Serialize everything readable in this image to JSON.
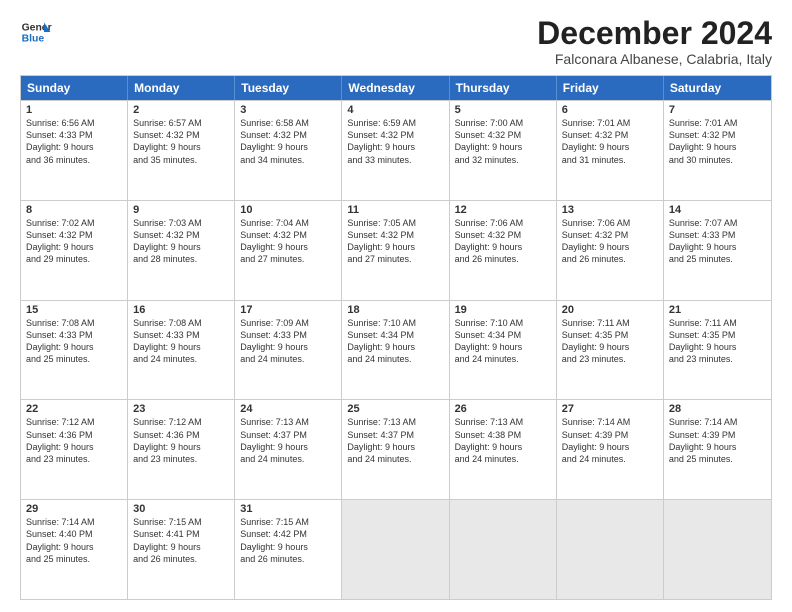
{
  "logo": {
    "line1": "General",
    "line2": "Blue"
  },
  "title": "December 2024",
  "location": "Falconara Albanese, Calabria, Italy",
  "headers": [
    "Sunday",
    "Monday",
    "Tuesday",
    "Wednesday",
    "Thursday",
    "Friday",
    "Saturday"
  ],
  "rows": [
    [
      {
        "day": "1",
        "lines": [
          "Sunrise: 6:56 AM",
          "Sunset: 4:33 PM",
          "Daylight: 9 hours",
          "and 36 minutes."
        ]
      },
      {
        "day": "2",
        "lines": [
          "Sunrise: 6:57 AM",
          "Sunset: 4:32 PM",
          "Daylight: 9 hours",
          "and 35 minutes."
        ]
      },
      {
        "day": "3",
        "lines": [
          "Sunrise: 6:58 AM",
          "Sunset: 4:32 PM",
          "Daylight: 9 hours",
          "and 34 minutes."
        ]
      },
      {
        "day": "4",
        "lines": [
          "Sunrise: 6:59 AM",
          "Sunset: 4:32 PM",
          "Daylight: 9 hours",
          "and 33 minutes."
        ]
      },
      {
        "day": "5",
        "lines": [
          "Sunrise: 7:00 AM",
          "Sunset: 4:32 PM",
          "Daylight: 9 hours",
          "and 32 minutes."
        ]
      },
      {
        "day": "6",
        "lines": [
          "Sunrise: 7:01 AM",
          "Sunset: 4:32 PM",
          "Daylight: 9 hours",
          "and 31 minutes."
        ]
      },
      {
        "day": "7",
        "lines": [
          "Sunrise: 7:01 AM",
          "Sunset: 4:32 PM",
          "Daylight: 9 hours",
          "and 30 minutes."
        ]
      }
    ],
    [
      {
        "day": "8",
        "lines": [
          "Sunrise: 7:02 AM",
          "Sunset: 4:32 PM",
          "Daylight: 9 hours",
          "and 29 minutes."
        ]
      },
      {
        "day": "9",
        "lines": [
          "Sunrise: 7:03 AM",
          "Sunset: 4:32 PM",
          "Daylight: 9 hours",
          "and 28 minutes."
        ]
      },
      {
        "day": "10",
        "lines": [
          "Sunrise: 7:04 AM",
          "Sunset: 4:32 PM",
          "Daylight: 9 hours",
          "and 27 minutes."
        ]
      },
      {
        "day": "11",
        "lines": [
          "Sunrise: 7:05 AM",
          "Sunset: 4:32 PM",
          "Daylight: 9 hours",
          "and 27 minutes."
        ]
      },
      {
        "day": "12",
        "lines": [
          "Sunrise: 7:06 AM",
          "Sunset: 4:32 PM",
          "Daylight: 9 hours",
          "and 26 minutes."
        ]
      },
      {
        "day": "13",
        "lines": [
          "Sunrise: 7:06 AM",
          "Sunset: 4:32 PM",
          "Daylight: 9 hours",
          "and 26 minutes."
        ]
      },
      {
        "day": "14",
        "lines": [
          "Sunrise: 7:07 AM",
          "Sunset: 4:33 PM",
          "Daylight: 9 hours",
          "and 25 minutes."
        ]
      }
    ],
    [
      {
        "day": "15",
        "lines": [
          "Sunrise: 7:08 AM",
          "Sunset: 4:33 PM",
          "Daylight: 9 hours",
          "and 25 minutes."
        ]
      },
      {
        "day": "16",
        "lines": [
          "Sunrise: 7:08 AM",
          "Sunset: 4:33 PM",
          "Daylight: 9 hours",
          "and 24 minutes."
        ]
      },
      {
        "day": "17",
        "lines": [
          "Sunrise: 7:09 AM",
          "Sunset: 4:33 PM",
          "Daylight: 9 hours",
          "and 24 minutes."
        ]
      },
      {
        "day": "18",
        "lines": [
          "Sunrise: 7:10 AM",
          "Sunset: 4:34 PM",
          "Daylight: 9 hours",
          "and 24 minutes."
        ]
      },
      {
        "day": "19",
        "lines": [
          "Sunrise: 7:10 AM",
          "Sunset: 4:34 PM",
          "Daylight: 9 hours",
          "and 24 minutes."
        ]
      },
      {
        "day": "20",
        "lines": [
          "Sunrise: 7:11 AM",
          "Sunset: 4:35 PM",
          "Daylight: 9 hours",
          "and 23 minutes."
        ]
      },
      {
        "day": "21",
        "lines": [
          "Sunrise: 7:11 AM",
          "Sunset: 4:35 PM",
          "Daylight: 9 hours",
          "and 23 minutes."
        ]
      }
    ],
    [
      {
        "day": "22",
        "lines": [
          "Sunrise: 7:12 AM",
          "Sunset: 4:36 PM",
          "Daylight: 9 hours",
          "and 23 minutes."
        ]
      },
      {
        "day": "23",
        "lines": [
          "Sunrise: 7:12 AM",
          "Sunset: 4:36 PM",
          "Daylight: 9 hours",
          "and 23 minutes."
        ]
      },
      {
        "day": "24",
        "lines": [
          "Sunrise: 7:13 AM",
          "Sunset: 4:37 PM",
          "Daylight: 9 hours",
          "and 24 minutes."
        ]
      },
      {
        "day": "25",
        "lines": [
          "Sunrise: 7:13 AM",
          "Sunset: 4:37 PM",
          "Daylight: 9 hours",
          "and 24 minutes."
        ]
      },
      {
        "day": "26",
        "lines": [
          "Sunrise: 7:13 AM",
          "Sunset: 4:38 PM",
          "Daylight: 9 hours",
          "and 24 minutes."
        ]
      },
      {
        "day": "27",
        "lines": [
          "Sunrise: 7:14 AM",
          "Sunset: 4:39 PM",
          "Daylight: 9 hours",
          "and 24 minutes."
        ]
      },
      {
        "day": "28",
        "lines": [
          "Sunrise: 7:14 AM",
          "Sunset: 4:39 PM",
          "Daylight: 9 hours",
          "and 25 minutes."
        ]
      }
    ],
    [
      {
        "day": "29",
        "lines": [
          "Sunrise: 7:14 AM",
          "Sunset: 4:40 PM",
          "Daylight: 9 hours",
          "and 25 minutes."
        ]
      },
      {
        "day": "30",
        "lines": [
          "Sunrise: 7:15 AM",
          "Sunset: 4:41 PM",
          "Daylight: 9 hours",
          "and 26 minutes."
        ]
      },
      {
        "day": "31",
        "lines": [
          "Sunrise: 7:15 AM",
          "Sunset: 4:42 PM",
          "Daylight: 9 hours",
          "and 26 minutes."
        ]
      },
      null,
      null,
      null,
      null
    ]
  ]
}
